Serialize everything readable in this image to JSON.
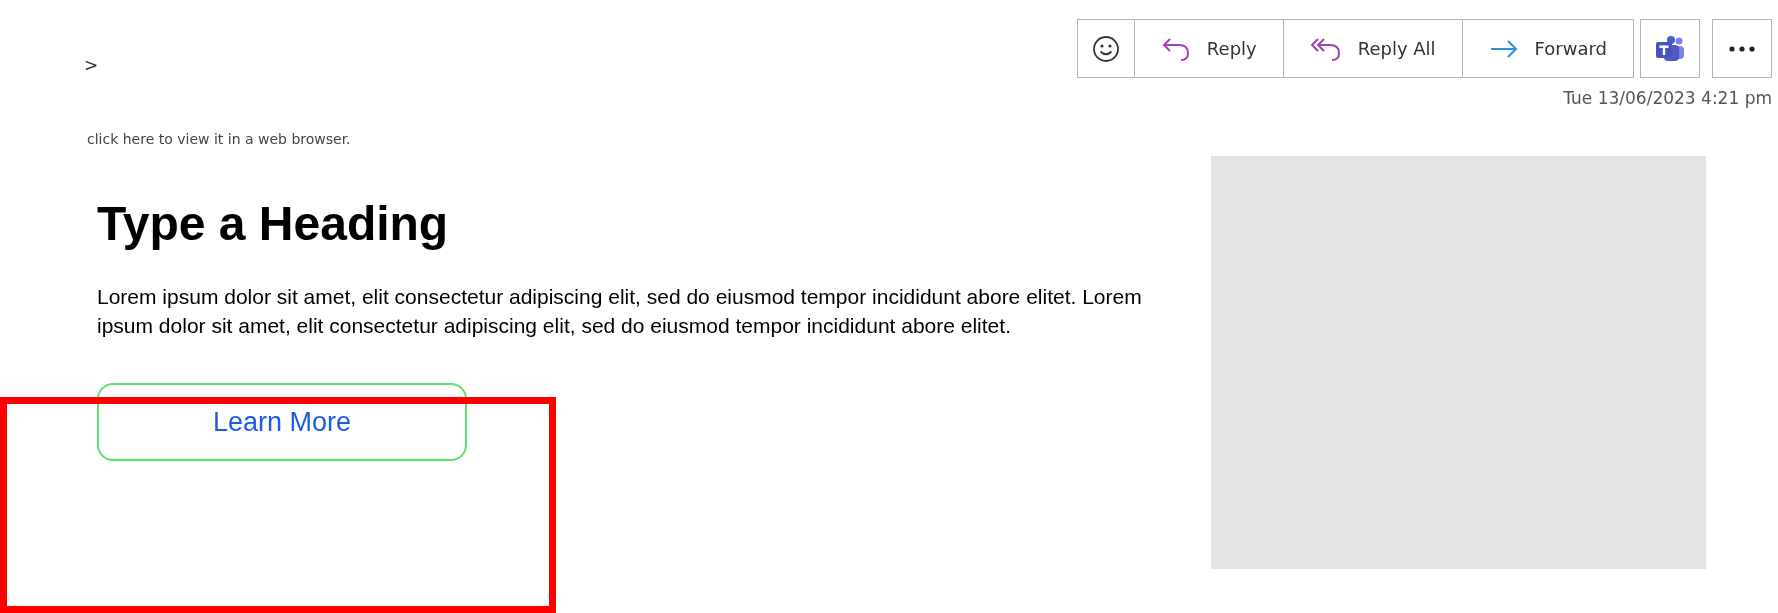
{
  "breadcrumb": ">",
  "actions": [
    {
      "kind": "emoji"
    },
    {
      "kind": "reply",
      "label": "Reply"
    },
    {
      "kind": "reply_all",
      "label": "Reply All"
    },
    {
      "kind": "forward",
      "label": "Forward"
    }
  ],
  "apps": [
    {
      "kind": "teams"
    },
    {
      "kind": "more"
    }
  ],
  "date": "Tue 13/06/2023 4:21 pm",
  "view_link": "click here to view it in a web browser.",
  "heading": "Type a Heading",
  "body": "Lorem ipsum dolor sit amet, elit consectetur adipiscing elit, sed do eiusmod tempor incididunt abore elitet. Lorem ipsum dolor sit amet, elit consectetur adipiscing elit, sed do eiusmod tempor incididunt abore elitet.",
  "cta": "Learn More",
  "image": {
    "kind": "placeholder"
  },
  "annotation": {
    "kind": "highlight"
  }
}
